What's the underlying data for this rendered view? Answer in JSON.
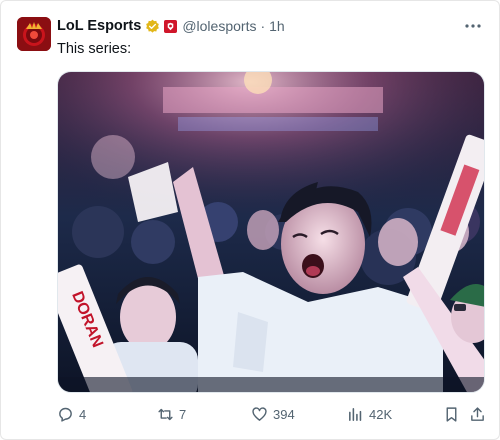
{
  "tweet": {
    "author_name": "LoL Esports",
    "handle": "@lolesports",
    "separator": "·",
    "time": "1h",
    "text": "This series:"
  },
  "media": {
    "banner_text": "DORAN"
  },
  "actions": {
    "replies": "4",
    "retweets": "7",
    "likes": "394",
    "views": "42K"
  },
  "icons": {
    "avatar": "lol-esports-logo",
    "verified": "gold-verified-badge-icon",
    "affiliate": "red-affiliate-badge-icon",
    "more": "more-dots-icon",
    "reply": "reply-icon",
    "retweet": "retweet-icon",
    "like": "heart-icon",
    "views": "views-bar-chart-icon",
    "bookmark": "bookmark-icon",
    "share": "share-icon"
  },
  "colors": {
    "verified_gold": "#e2b719",
    "affiliate_red": "#d0162a",
    "secondary_text": "#536471"
  }
}
